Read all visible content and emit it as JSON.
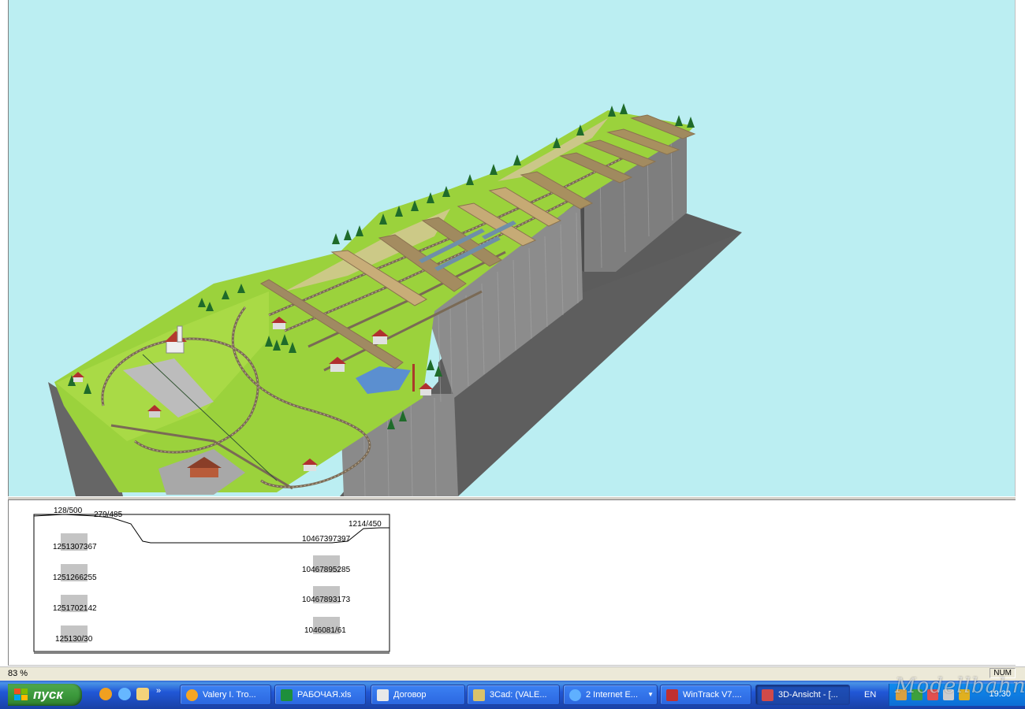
{
  "profile": {
    "labels": [
      {
        "text": "128/500"
      },
      {
        "text": "279/485"
      },
      {
        "text": "1214/450"
      },
      {
        "text": "1251307367"
      },
      {
        "text": "1251266255"
      },
      {
        "text": "1251702142"
      },
      {
        "text": "125130/30"
      },
      {
        "text": "10467397397"
      },
      {
        "text": "10467895285"
      },
      {
        "text": "10467893173"
      },
      {
        "text": "1046081/61"
      }
    ]
  },
  "status": {
    "zoom": "83 %",
    "num": "NUM"
  },
  "taskbar": {
    "start_label": "пуск",
    "lang": "EN",
    "clock": "19:30",
    "tasks": [
      {
        "label": "Valery I. Tro...",
        "icon": "browser-icon",
        "color": "#f5a623"
      },
      {
        "label": "РАБОЧАЯ.xls",
        "icon": "excel-icon",
        "color": "#1e8f3c"
      },
      {
        "label": "Договор",
        "icon": "document-icon",
        "color": "#e8e8e8"
      },
      {
        "label": "3Cad: (VALE...",
        "icon": "cad-icon",
        "color": "#d9c26b"
      },
      {
        "label": "2 Internet E...",
        "icon": "internet-explorer-icon",
        "color": "#5fb0ff"
      },
      {
        "label": "WinTrack  V7....",
        "icon": "wintrack-icon",
        "color": "#c03030"
      },
      {
        "label": "3D-Ansicht - [...",
        "icon": "3d-view-icon",
        "color": "#d04a4a"
      }
    ]
  },
  "watermark": "Modellbahn",
  "colors": {
    "sky": "#bbeef2",
    "terrain": "#9bd23c",
    "cliff": "#8a8a8a",
    "shadow": "#5a5a5a",
    "taskbar": "#2157d7",
    "start": "#3c9a3c"
  }
}
